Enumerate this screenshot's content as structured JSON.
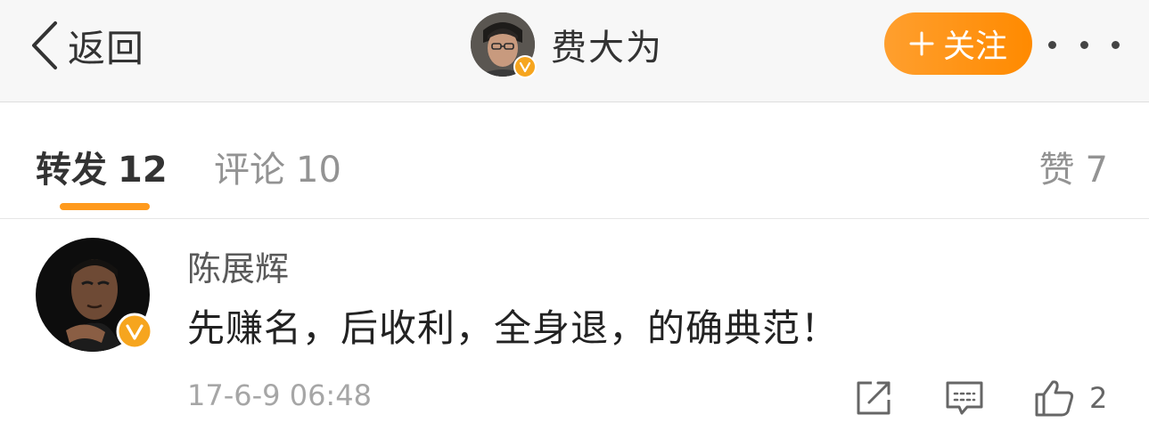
{
  "navbar": {
    "back_label": "返回",
    "user_name": "费大为",
    "follow_label": "关注",
    "icons": {
      "back": "chevron-left-icon",
      "avatar": "user-avatar",
      "verified": "verified-badge-icon",
      "plus": "plus-icon",
      "more": "more-dots-icon"
    },
    "colors": {
      "follow_button": "#ff8a00",
      "verified_badge": "#f6a51e"
    }
  },
  "tabs": {
    "repost": {
      "label": "转发",
      "count": "12",
      "active": true
    },
    "comment": {
      "label": "评论",
      "count": "10"
    },
    "like": {
      "label": "赞",
      "count": "7"
    },
    "indicator_color": "#ff9a1d"
  },
  "comment": {
    "author": "陈展辉",
    "text": "先赚名，后收利，全身退，的确典范！",
    "time": "17-6-9 06:48",
    "like_count": "2",
    "icons": {
      "share": "share-icon",
      "reply": "comment-icon",
      "like": "thumbs-up-icon"
    }
  }
}
